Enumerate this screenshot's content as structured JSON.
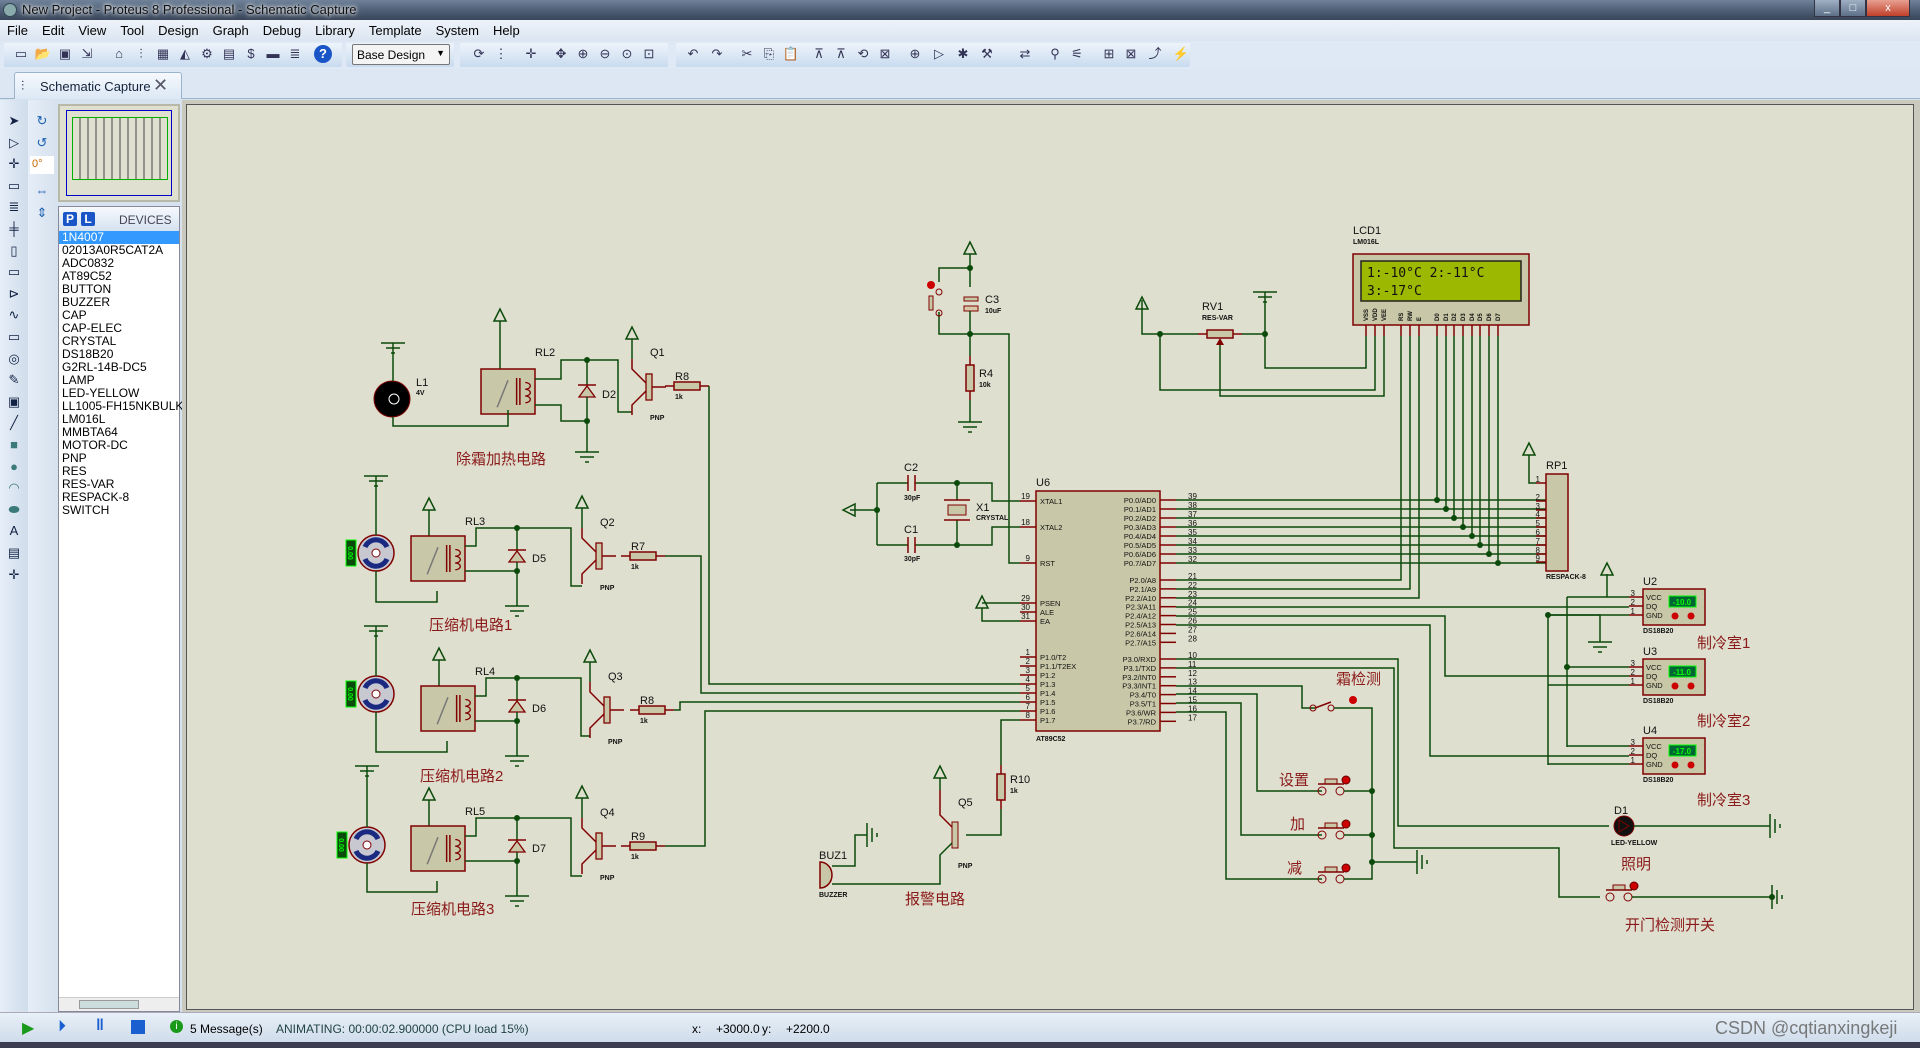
{
  "window": {
    "title": "New Project - Proteus 8 Professional - Schematic Capture",
    "minimize": "_",
    "maximize": "□",
    "close": "x"
  },
  "menu": [
    "File",
    "Edit",
    "View",
    "Tool",
    "Design",
    "Graph",
    "Debug",
    "Library",
    "Template",
    "System",
    "Help"
  ],
  "toolbar": {
    "design_select": "Base Design"
  },
  "tab": {
    "label": "Schematic Capture",
    "close": "✕"
  },
  "side": {
    "rotation": "0°"
  },
  "devices": {
    "p_label": "P",
    "l_label": "L",
    "header": "DEVICES",
    "selected": "1N4007",
    "items": [
      "1N4007",
      "02013A0R5CAT2A",
      "ADC0832",
      "AT89C52",
      "BUTTON",
      "BUZZER",
      "CAP",
      "CAP-ELEC",
      "CRYSTAL",
      "DS18B20",
      "G2RL-14B-DC5",
      "LAMP",
      "LED-YELLOW",
      "LL1005-FH15NKBULK",
      "LM016L",
      "MMBTA64",
      "MOTOR-DC",
      "PNP",
      "RES",
      "RES-VAR",
      "RESPACK-8",
      "SWITCH"
    ]
  },
  "status": {
    "messages": "5 Message(s)",
    "animating": "ANIMATING: 00:00:02.900000 (CPU load 15%)",
    "x_label": "x:",
    "x": "+3000.0",
    "y_label": "y:",
    "y": "+2200.0"
  },
  "watermark": "CSDN @cqtianxingkeji",
  "colors": {
    "canvas": "#dfdfcf",
    "wire": "#0b4a0b",
    "component": "#800000",
    "body": "#c8c8a8",
    "label": "#8b1a1a",
    "lcd_screen": "#9cb800",
    "sensor_display": "#00ff00"
  },
  "schematic": {
    "labels": {
      "defrost": "除霜加热电路",
      "comp1": "压缩机电路1",
      "comp2": "压缩机电路2",
      "comp3": "压缩机电路3",
      "alarm": "报警电路",
      "frost": "霜检测",
      "set": "设置",
      "plus": "加",
      "minus": "减",
      "light": "照明",
      "door": "开门检测开关",
      "room1": "制冷室1",
      "room2": "制冷室2",
      "room3": "制冷室3"
    },
    "refs": {
      "L1": "L1",
      "L1v": "4V",
      "RL2": "RL2",
      "D2": "D2",
      "Q1": "Q1",
      "Q1v": "PNP",
      "R8a": "R8",
      "R8av": "1k",
      "RL3": "RL3",
      "D5": "D5",
      "Q2": "Q2",
      "Q2v": "PNP",
      "R7": "R7",
      "R7v": "1k",
      "RL4": "RL4",
      "D6": "D6",
      "Q3": "Q3",
      "Q3v": "PNP",
      "R8b": "R8",
      "R8bv": "1k",
      "RL5": "RL5",
      "D7": "D7",
      "Q4": "Q4",
      "Q4v": "PNP",
      "R9": "R9",
      "R9v": "1k",
      "C3": "C3",
      "C3v": "10uF",
      "R4": "R4",
      "R4v": "10k",
      "C2": "C2",
      "C2v": "30pF",
      "C1": "C1",
      "C1v": "30pF",
      "X1": "X1",
      "X1v": "CRYSTAL",
      "RV1": "RV1",
      "RV1v": "RES-VAR",
      "BUZ1": "BUZ1",
      "BUZ1v": "BUZZER",
      "Q5": "Q5",
      "Q5v": "PNP",
      "R10": "R10",
      "R10v": "1k",
      "RP1": "RP1",
      "RP1v": "RESPACK-8",
      "D1": "D1",
      "D1v": "LED-YELLOW"
    },
    "motor_readout": "0.00",
    "lcd": {
      "ref": "LCD1",
      "model": "LM016L",
      "line1": "1:-10°C 2:-11°C",
      "line2": "3:-17°C",
      "pins": [
        "VSS",
        "VDD",
        "VEE",
        "RS",
        "RW",
        "E",
        "D0",
        "D1",
        "D2",
        "D3",
        "D4",
        "D5",
        "D6",
        "D7"
      ]
    },
    "mcu": {
      "ref": "U6",
      "model": "AT89C52",
      "left": [
        {
          "n": "19",
          "l": "XTAL1"
        },
        {
          "n": "18",
          "l": "XTAL2"
        },
        {
          "n": "9",
          "l": "RST"
        },
        {
          "n": "29",
          "l": "PSEN"
        },
        {
          "n": "30",
          "l": "ALE"
        },
        {
          "n": "31",
          "l": "EA"
        },
        {
          "n": "1",
          "l": "P1.0/T2"
        },
        {
          "n": "2",
          "l": "P1.1/T2EX"
        },
        {
          "n": "3",
          "l": "P1.2"
        },
        {
          "n": "4",
          "l": "P1.3"
        },
        {
          "n": "5",
          "l": "P1.4"
        },
        {
          "n": "6",
          "l": "P1.5"
        },
        {
          "n": "7",
          "l": "P1.6"
        },
        {
          "n": "8",
          "l": "P1.7"
        }
      ],
      "right": [
        {
          "n": "39",
          "l": "P0.0/AD0"
        },
        {
          "n": "38",
          "l": "P0.1/AD1"
        },
        {
          "n": "37",
          "l": "P0.2/AD2"
        },
        {
          "n": "36",
          "l": "P0.3/AD3"
        },
        {
          "n": "35",
          "l": "P0.4/AD4"
        },
        {
          "n": "34",
          "l": "P0.5/AD5"
        },
        {
          "n": "33",
          "l": "P0.6/AD6"
        },
        {
          "n": "32",
          "l": "P0.7/AD7"
        },
        {
          "n": "21",
          "l": "P2.0/A8"
        },
        {
          "n": "22",
          "l": "P2.1/A9"
        },
        {
          "n": "23",
          "l": "P2.2/A10"
        },
        {
          "n": "24",
          "l": "P2.3/A11"
        },
        {
          "n": "25",
          "l": "P2.4/A12"
        },
        {
          "n": "26",
          "l": "P2.5/A13"
        },
        {
          "n": "27",
          "l": "P2.6/A14"
        },
        {
          "n": "28",
          "l": "P2.7/A15"
        },
        {
          "n": "10",
          "l": "P3.0/RXD"
        },
        {
          "n": "11",
          "l": "P3.1/TXD"
        },
        {
          "n": "12",
          "l": "P3.2/INT0"
        },
        {
          "n": "13",
          "l": "P3.3/INT1"
        },
        {
          "n": "14",
          "l": "P3.4/T0"
        },
        {
          "n": "15",
          "l": "P3.5/T1"
        },
        {
          "n": "16",
          "l": "P3.6/WR"
        },
        {
          "n": "17",
          "l": "P3.7/RD"
        }
      ]
    },
    "rp1_pins": [
      "1",
      "2",
      "3",
      "4",
      "5",
      "6",
      "7",
      "8",
      "9"
    ],
    "sensors": [
      {
        "ref": "U2",
        "value": "-10.0",
        "model": "DS18B20"
      },
      {
        "ref": "U3",
        "value": "-11.0",
        "model": "DS18B20"
      },
      {
        "ref": "U4",
        "value": "-17.0",
        "model": "DS18B20"
      }
    ],
    "sensor_pins": [
      {
        "n": "3",
        "l": "VCC"
      },
      {
        "n": "2",
        "l": "DQ"
      },
      {
        "n": "1",
        "l": "GND"
      }
    ]
  }
}
